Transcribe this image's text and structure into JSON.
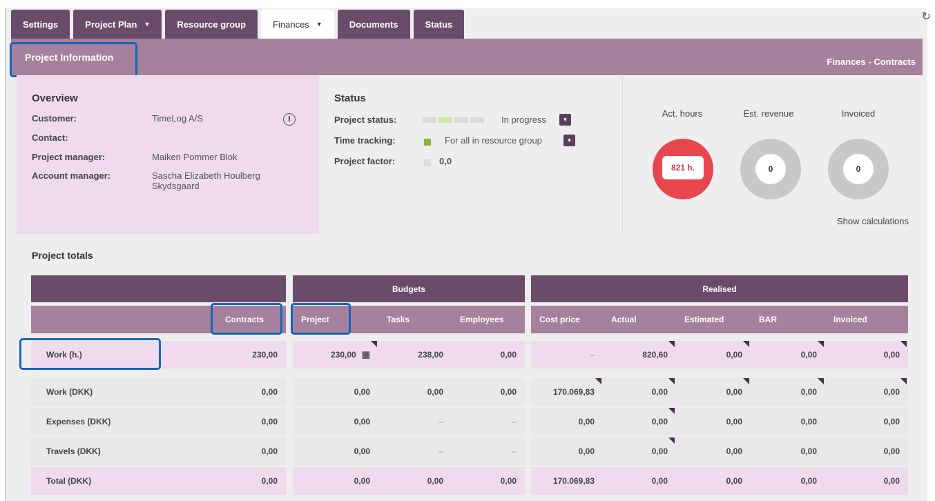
{
  "tabs": [
    {
      "label": "Settings",
      "dropdown": false
    },
    {
      "label": "Project Plan",
      "dropdown": true
    },
    {
      "label": "Resource group",
      "dropdown": false
    },
    {
      "label": "Finances",
      "dropdown": true,
      "active": true
    },
    {
      "label": "Documents",
      "dropdown": false
    },
    {
      "label": "Status",
      "dropdown": false
    }
  ],
  "header": {
    "section": "Project Information",
    "breadcrumb": "Finances - Contracts"
  },
  "overview": {
    "title": "Overview",
    "rows": [
      {
        "key": "Customer:",
        "value": "TimeLog A/S"
      },
      {
        "key": "Contact:",
        "value": ""
      },
      {
        "key": "Project manager:",
        "value": "Maiken Pommer Blok"
      },
      {
        "key": "Account manager:",
        "value": "Sascha Elizabeth Houlberg Skydsgaard"
      }
    ]
  },
  "status": {
    "title": "Status",
    "project_status_label": "Project status:",
    "project_status_value": "In progress",
    "time_tracking_label": "Time tracking:",
    "time_tracking_value": "For all in resource group",
    "project_factor_label": "Project factor:",
    "project_factor_value": "0,0",
    "colors": {
      "progress_on": "#d5e6a8",
      "progress_off": "#dcdcdc",
      "tracking": "#8db33a"
    }
  },
  "kpis": {
    "items": [
      {
        "label": "Act. hours",
        "value": "821 h."
      },
      {
        "label": "Est. revenue",
        "value": "0"
      },
      {
        "label": "Invoiced",
        "value": "0"
      }
    ],
    "show_calculations": "Show calculations"
  },
  "totals": {
    "title": "Project totals",
    "group_headers": {
      "budgets": "Budgets",
      "realised": "Realised"
    },
    "columns": [
      "Contracts",
      "Project",
      "Tasks",
      "Employees",
      "Cost price",
      "Actual",
      "Estimated",
      "BAR",
      "Invoiced"
    ],
    "rows": [
      {
        "label": "Work (h.)",
        "values": [
          "230,00",
          "230,00",
          "238,00",
          "0,00",
          "–",
          "820,60",
          "0,00",
          "0,00",
          "0,00"
        ]
      },
      {
        "label": "Work (DKK)",
        "values": [
          "0,00",
          "0,00",
          "0,00",
          "0,00",
          "170.069,83",
          "0,00",
          "0,00",
          "0,00",
          "0,00"
        ]
      },
      {
        "label": "Expenses (DKK)",
        "values": [
          "0,00",
          "0,00",
          "–",
          "–",
          "0,00",
          "0,00",
          "0,00",
          "0,00",
          "0,00"
        ]
      },
      {
        "label": "Travels (DKK)",
        "values": [
          "0,00",
          "0,00",
          "–",
          "–",
          "0,00",
          "0,00",
          "0,00",
          "0,00",
          "0,00"
        ]
      },
      {
        "label": "Total (DKK)",
        "values": [
          "0,00",
          "0,00",
          "0,00",
          "0,00",
          "170.069,83",
          "0,00",
          "0,00",
          "0,00",
          "0,00"
        ]
      }
    ]
  },
  "colors": {
    "tab_bg": "#6b4b6a",
    "header_bar": "#a6819e",
    "pink_panel": "#efdaee",
    "highlight": "#1565b8",
    "act_hours_ring": "#e8464e"
  }
}
